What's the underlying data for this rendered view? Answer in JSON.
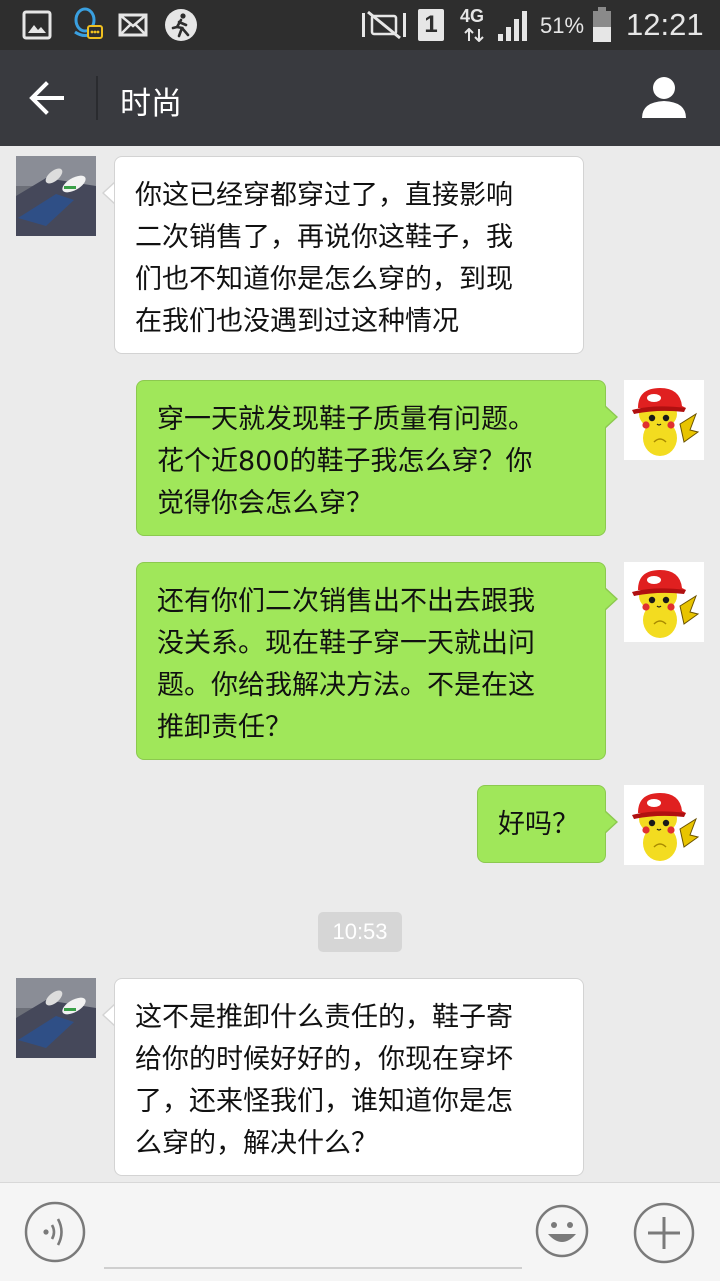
{
  "status_bar": {
    "network": "4G",
    "sim_slot": "1",
    "battery": "51%",
    "time": "12:21",
    "icons": [
      "gallery-icon",
      "qq-notification-icon",
      "mail-icon",
      "step-counter-icon",
      "mute-icon",
      "sim-icon",
      "network-arrows-icon",
      "signal-icon",
      "battery-icon"
    ]
  },
  "header": {
    "title": "时尚",
    "back_icon": "arrow-left-icon",
    "profile_icon": "person-icon"
  },
  "messages": [
    {
      "side": "left",
      "sender": "seller",
      "lines": [
        "你这已经穿都穿过了，直接影响",
        "二次销售了，再说你这鞋子，我",
        "们也不知道你是怎么穿的，到现",
        "在我们也没遇到过这种情况"
      ]
    },
    {
      "side": "right",
      "sender": "me",
      "lines": [
        "穿一天就发现鞋子质量有问题。",
        "花个近800的鞋子我怎么穿？你",
        "觉得你会怎么穿？"
      ]
    },
    {
      "side": "right",
      "sender": "me",
      "lines": [
        "还有你们二次销售出不出去跟我",
        "没关系。现在鞋子穿一天就出问",
        "题。你给我解决方法。不是在这",
        "推卸责任？"
      ]
    },
    {
      "side": "right",
      "sender": "me",
      "lines": [
        "好吗？"
      ]
    },
    {
      "side": "left",
      "sender": "seller",
      "lines": [
        "这不是推卸什么责任的，鞋子寄",
        "给你的时候好好的，你现在穿坏",
        "了，还来怪我们，谁知道你是怎",
        "么穿的，解决什么？"
      ]
    }
  ],
  "timestamp": "10:53",
  "input_bar": {
    "voice_icon": "voice-icon",
    "input_value": "",
    "emoji_icon": "emoji-icon",
    "plus_icon": "plus-icon"
  },
  "colors": {
    "status_bar": "#2e2e2e",
    "title_bar": "#393a3f",
    "chat_background": "#ebebeb",
    "my_bubble": "#a0e75a",
    "their_bubble": "#ffffff"
  }
}
